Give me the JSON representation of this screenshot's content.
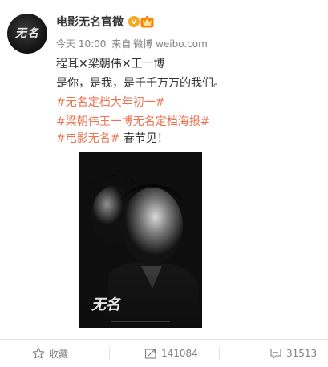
{
  "post": {
    "author": {
      "name": "电影无名官微",
      "avatar_icon": "avatar-logo-icon",
      "verified_icon": "verified-v-icon",
      "vip_icon": "vip-crown-icon"
    },
    "meta": {
      "time": "今天 10:00",
      "source_prefix": "来自",
      "source": "微博 weibo.com"
    },
    "lines": {
      "cast": "程耳✕梁朝伟✕王一博",
      "slogan": "是你，是我，是千千万万的我们。",
      "tag1": "#无名定档大年初一#",
      "tag2": "#梁朝伟王一博无名定档海报#",
      "tag3": "#电影无名#",
      "tail": " 春节见！"
    },
    "poster": {
      "alt": "film-poster-image"
    }
  },
  "actions": {
    "favorite": {
      "label": "收藏",
      "icon": "star-icon"
    },
    "repost": {
      "count": "141084",
      "icon": "repost-icon"
    },
    "comment": {
      "count": "31513",
      "icon": "comment-icon"
    }
  },
  "colors": {
    "tag": "#eb7350",
    "meta": "#808080",
    "text": "#333333",
    "verified": "#f5a623"
  }
}
